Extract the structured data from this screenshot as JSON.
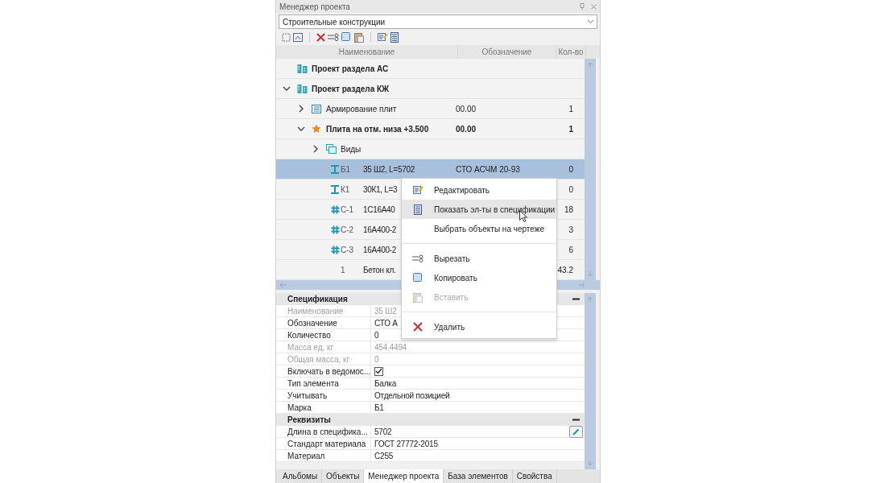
{
  "window": {
    "title": "Менеджер проекта"
  },
  "project_select": {
    "value": "Строительные конструкции"
  },
  "tree": {
    "columns": [
      "Наименование",
      "Обозначение",
      "Кол-во"
    ],
    "items": [
      {
        "kind": "building",
        "name": "Проект раздела АС",
        "bold": true,
        "selected": false
      },
      {
        "kind": "building",
        "name": "Проект раздела КЖ",
        "bold": true,
        "selected": false,
        "expanded": true,
        "children": [
          {
            "kind": "layers",
            "name": "Армирование плит",
            "designation": "00.00",
            "qty": "1",
            "bold": false,
            "selected": false,
            "expanded": false
          },
          {
            "kind": "star",
            "name": "Плита на отм. низа +3.500",
            "designation": "00.00",
            "qty": "1",
            "bold": true,
            "selected": false,
            "expanded": true,
            "children": [
              {
                "kind": "views",
                "name": "Виды",
                "bold": false,
                "selected": false,
                "expanded": false
              },
              {
                "kind": "beam",
                "mark": "Б1",
                "name": "35 Ш2, L=5702",
                "designation": "СТО АСЧМ 20-93",
                "qty": "0",
                "bold": false,
                "selected": true
              },
              {
                "kind": "beam",
                "mark": "К1",
                "name": "30К1, L=3",
                "qty": "0",
                "bold": false,
                "selected": false
              },
              {
                "kind": "rebar",
                "mark": "С-1",
                "name": "1С16А40",
                "qty": "18",
                "bold": false,
                "selected": false
              },
              {
                "kind": "rebar",
                "mark": "С-2",
                "name": "16А400-2",
                "qty": "3",
                "bold": false,
                "selected": false
              },
              {
                "kind": "rebar",
                "mark": "С-3",
                "name": "16А400-2",
                "qty": "6",
                "bold": false,
                "selected": false
              },
              {
                "kind": "plain",
                "mark": "1",
                "name": "Бетон кл.",
                "qty": "43.2",
                "bold": false,
                "selected": false
              }
            ]
          }
        ]
      }
    ]
  },
  "context_menu": [
    {
      "kind": "edit",
      "label": "Редактировать",
      "disabled": false,
      "selected": false
    },
    {
      "kind": "spec",
      "label": "Показать эл-ты в спецификации",
      "disabled": false,
      "selected": true
    },
    {
      "kind": "none",
      "label": "Выбрать объекты на чертеже",
      "disabled": false,
      "selected": false
    },
    {
      "kind": "separator"
    },
    {
      "kind": "cut",
      "label": "Вырезать",
      "disabled": false,
      "selected": false
    },
    {
      "kind": "copy",
      "label": "Копировать",
      "disabled": false,
      "selected": false
    },
    {
      "kind": "paste",
      "label": "Вставить",
      "disabled": true,
      "selected": false
    },
    {
      "kind": "separator"
    },
    {
      "kind": "delete",
      "label": "Удалить",
      "disabled": false,
      "selected": false
    }
  ],
  "properties": [
    {
      "title": "Спецификация",
      "expanded": true,
      "rows": [
        {
          "kind": "text",
          "label": "Наименование",
          "value": "35 Ш2",
          "disabled": true
        },
        {
          "kind": "text",
          "label": "Обозначение",
          "value": "СТО А",
          "disabled": false
        },
        {
          "kind": "text",
          "label": "Количество",
          "value": "0",
          "disabled": false
        },
        {
          "kind": "text",
          "label": "Масса ед, кг",
          "value": "454.4494",
          "disabled": true
        },
        {
          "kind": "text",
          "label": "Общая масса, кг",
          "value": "0",
          "disabled": true
        },
        {
          "kind": "checkbox",
          "label": "Включать в ведомос...",
          "checked": true,
          "disabled": false
        },
        {
          "kind": "text",
          "label": "Тип элемента",
          "value": "Балка",
          "disabled": false
        },
        {
          "kind": "text",
          "label": "Учитывать",
          "value": "Отдельной позицией",
          "disabled": false
        },
        {
          "kind": "text",
          "label": "Марка",
          "value": "Б1",
          "disabled": false
        }
      ]
    },
    {
      "title": "Реквизиты",
      "expanded": true,
      "rows": [
        {
          "kind": "editable",
          "label": "Длина в специфика...",
          "value": "5702",
          "disabled": false
        },
        {
          "kind": "text",
          "label": "Стандарт материала",
          "value": "ГОСТ 27772-2015",
          "disabled": false
        },
        {
          "kind": "text",
          "label": "Материал",
          "value": "С255",
          "disabled": false
        }
      ]
    }
  ],
  "bottom_tabs": [
    {
      "label": "Альбомы",
      "selected": false
    },
    {
      "label": "Объекты",
      "selected": false
    },
    {
      "label": "Менеджер проекта",
      "selected": true
    },
    {
      "label": "База элементов",
      "selected": false
    },
    {
      "label": "Свойства",
      "selected": false
    }
  ]
}
